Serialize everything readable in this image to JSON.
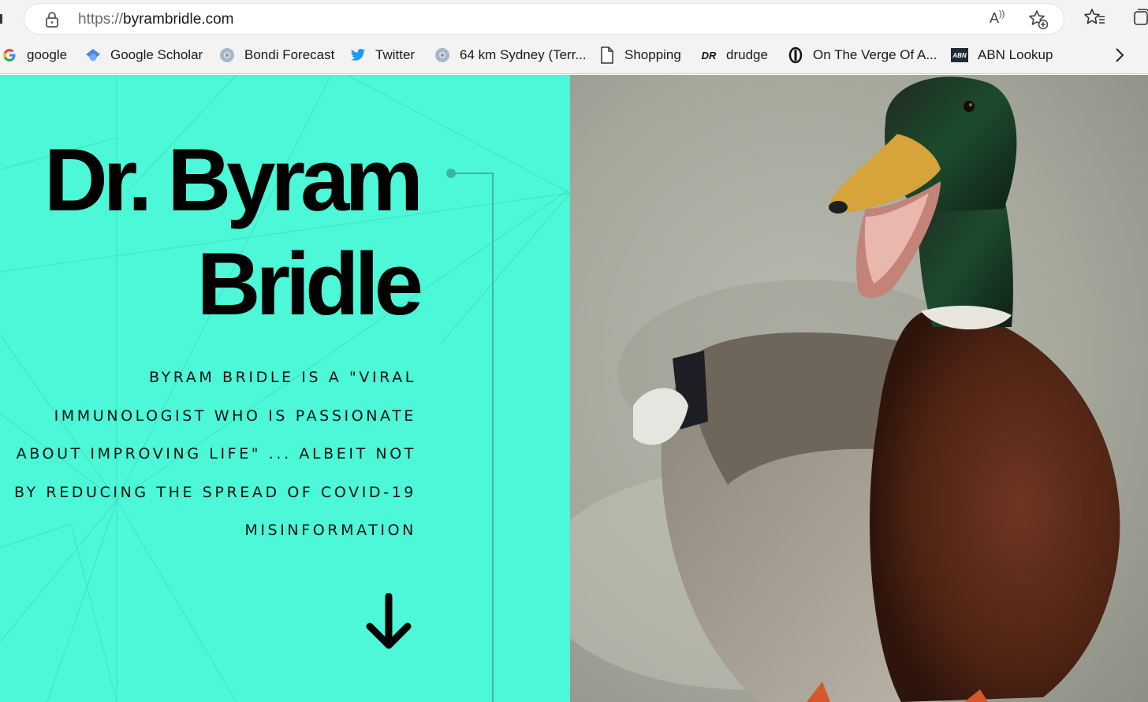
{
  "browser": {
    "url_scheme": "https://",
    "url_host": "byrambridle.com",
    "read_aloud_label": "A",
    "bookmarks": [
      {
        "label": "google",
        "icon": "google-icon"
      },
      {
        "label": "Google Scholar",
        "icon": "scholar-icon"
      },
      {
        "label": "Bondi Forecast",
        "icon": "globe-icon"
      },
      {
        "label": "Twitter",
        "icon": "twitter-icon"
      },
      {
        "label": "64 km Sydney (Terr...",
        "icon": "globe-icon"
      },
      {
        "label": "Shopping",
        "icon": "page-icon"
      },
      {
        "label": "drudge",
        "icon": "drudge-icon"
      },
      {
        "label": "On The Verge Of A...",
        "icon": "verge-icon"
      },
      {
        "label": "ABN Lookup",
        "icon": "abn-icon"
      }
    ],
    "drudge_badge": "DR",
    "abn_badge": "ABN"
  },
  "hero": {
    "title_line1": "Dr. Byram",
    "title_line2": "Bridle",
    "subtitle_lines": [
      "BYRAM BRIDLE IS A \"VIRAL",
      "IMMUNOLOGIST WHO IS PASSIONATE",
      "ABOUT IMPROVING LIFE\" ... ALBEIT NOT",
      "BY REDUCING THE SPREAD OF COVID-19",
      "MISINFORMATION"
    ],
    "background_color": "#4cf8d7",
    "accent_line_color": "#39b7a2"
  },
  "image": {
    "subject": "mallard-duck-photo"
  }
}
